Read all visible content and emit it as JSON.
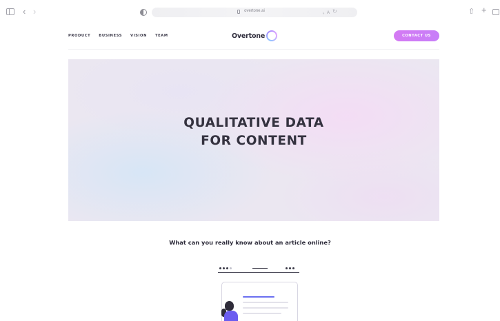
{
  "browser": {
    "url": "overtone.ai",
    "icons": [
      "sidebar-icon",
      "back-icon",
      "forward-icon",
      "privacy-icon",
      "lock-icon",
      "translate-icon",
      "reload-icon",
      "share-icon",
      "new-tab-icon",
      "tab-overview-icon"
    ]
  },
  "nav": {
    "links": [
      "PRODUCT",
      "BUSINESS",
      "VISION",
      "TEAM"
    ],
    "logo_text": "Overtone",
    "contact_label": "CONTACT US"
  },
  "hero": {
    "title_line1": "QUALITATIVE DATA",
    "title_line2": "FOR CONTENT"
  },
  "main": {
    "question": "What can you really know about an article online?"
  },
  "colors": {
    "accent": "#cf7cf5",
    "text_dark": "#2d2b3a",
    "illustration_purple": "#6b5cf0"
  }
}
